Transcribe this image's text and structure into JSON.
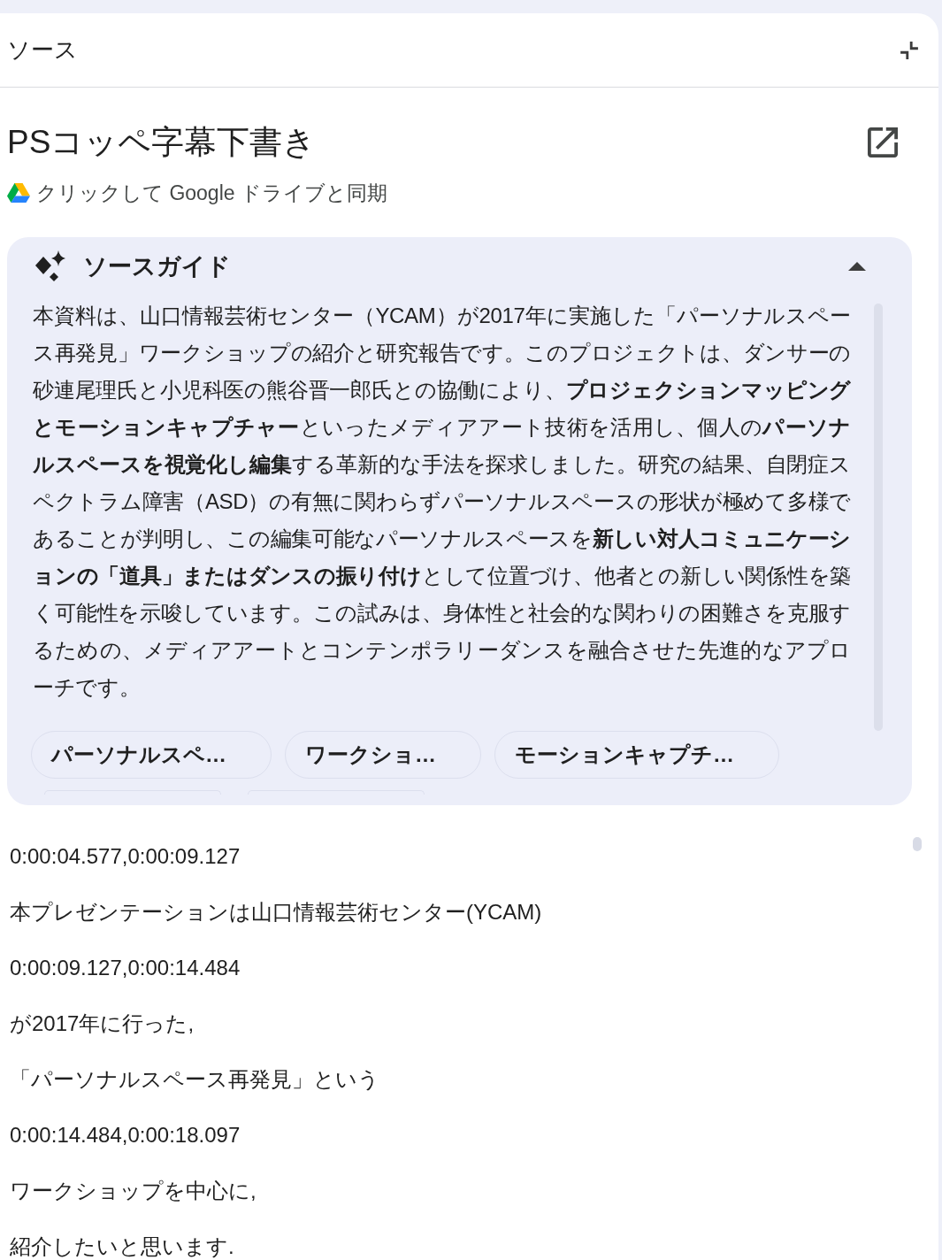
{
  "panel": {
    "title": "ソース"
  },
  "source": {
    "title": "PSコッペ字幕下書き",
    "sync_link": "クリックして Google ドライブと同期"
  },
  "source_guide": {
    "title": "ソースガイド",
    "expanded": true,
    "summary": "本資料は、山口情報芸術センター（YCAM）が2017年に実施した「パーソナルスペース再発見」ワークショップの紹介と研究報告です。このプロジェクトは、ダンサーの砂連尾理氏と小児科医の熊谷晋一郎氏との協働により、**プロジェクションマッピングとモーションキャプチャー**といったメディアアート技術を活用し、個人の**パーソナルスペースを視覚化し編集**する革新的な手法を探求しました。研究の結果、自閉症スペクトラム障害（ASD）の有無に関わらずパーソナルスペースの形状が極めて多様であることが判明し、この編集可能なパーソナルスペースを**新しい対人コミュニケーションの「道具」またはダンスの振り付け**として位置づけ、他者との新しい関係性を築く可能性を示唆しています。この試みは、身体性と社会的な関わりの困難さを克服するための、メディアアートとコンテンポラリーダンスを融合させた先進的なアプローチです。",
    "topics": [
      {
        "kind": "chip",
        "label": "パーソナルスペ…"
      },
      {
        "kind": "chip",
        "label": "ワークショ…"
      },
      {
        "kind": "chip",
        "label": "モーションキャプチ…"
      },
      {
        "kind": "cut_off"
      },
      {
        "kind": "cut_off"
      }
    ]
  },
  "transcript": {
    "lines": [
      "0:00:04.577,0:00:09.127",
      "本プレゼンテーションは山口情報芸術センター(YCAM)",
      "0:00:09.127,0:00:14.484",
      "が2017年に行った,",
      "「パーソナルスペース再発見」という",
      "0:00:14.484,0:00:18.097",
      "ワークショップを中心に,",
      "紹介したいと思います."
    ]
  }
}
